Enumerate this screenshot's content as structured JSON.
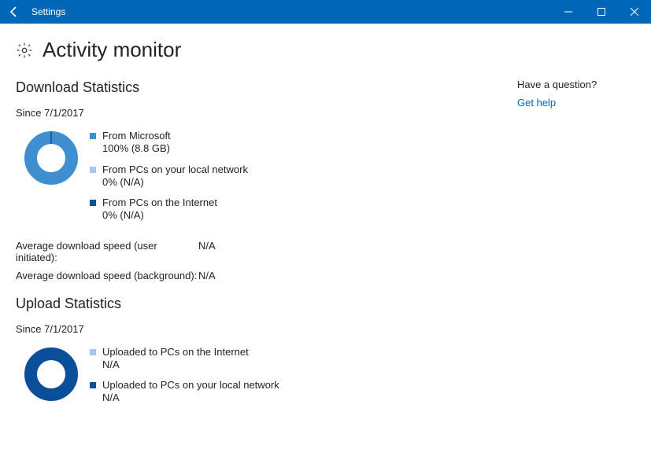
{
  "window": {
    "title": "Settings"
  },
  "page": {
    "title": "Activity monitor"
  },
  "download": {
    "heading": "Download Statistics",
    "since": "Since 7/1/2017",
    "legend": [
      {
        "color": "#3e8ed0",
        "label": "From Microsoft",
        "value": "100% (8.8 GB)"
      },
      {
        "color": "#a7c8eb",
        "label": "From PCs on your local network",
        "value": "0% (N/A)"
      },
      {
        "color": "#0b4f9b",
        "label": "From PCs on the Internet",
        "value": "0% (N/A)"
      }
    ],
    "speeds": [
      {
        "label": "Average download speed (user initiated):",
        "value": "N/A"
      },
      {
        "label": "Average download speed (background):",
        "value": "N/A"
      }
    ]
  },
  "upload": {
    "heading": "Upload Statistics",
    "since": "Since 7/1/2017",
    "legend": [
      {
        "color": "#a7c8eb",
        "label": "Uploaded to PCs on the Internet",
        "value": "N/A"
      },
      {
        "color": "#0b4f9b",
        "label": "Uploaded to PCs on your local network",
        "value": "N/A"
      }
    ]
  },
  "side": {
    "heading": "Have a question?",
    "link": "Get help"
  },
  "chart_data": [
    {
      "type": "pie",
      "title": "Download Statistics",
      "categories": [
        "From Microsoft",
        "From PCs on your local network",
        "From PCs on the Internet"
      ],
      "values": [
        100,
        0,
        0
      ],
      "colors": [
        "#3e8ed0",
        "#a7c8eb",
        "#0b4f9b"
      ]
    },
    {
      "type": "pie",
      "title": "Upload Statistics",
      "categories": [
        "Uploaded to PCs on the Internet",
        "Uploaded to PCs on your local network"
      ],
      "values": [
        0,
        0
      ],
      "colors": [
        "#a7c8eb",
        "#0b4f9b"
      ]
    }
  ]
}
